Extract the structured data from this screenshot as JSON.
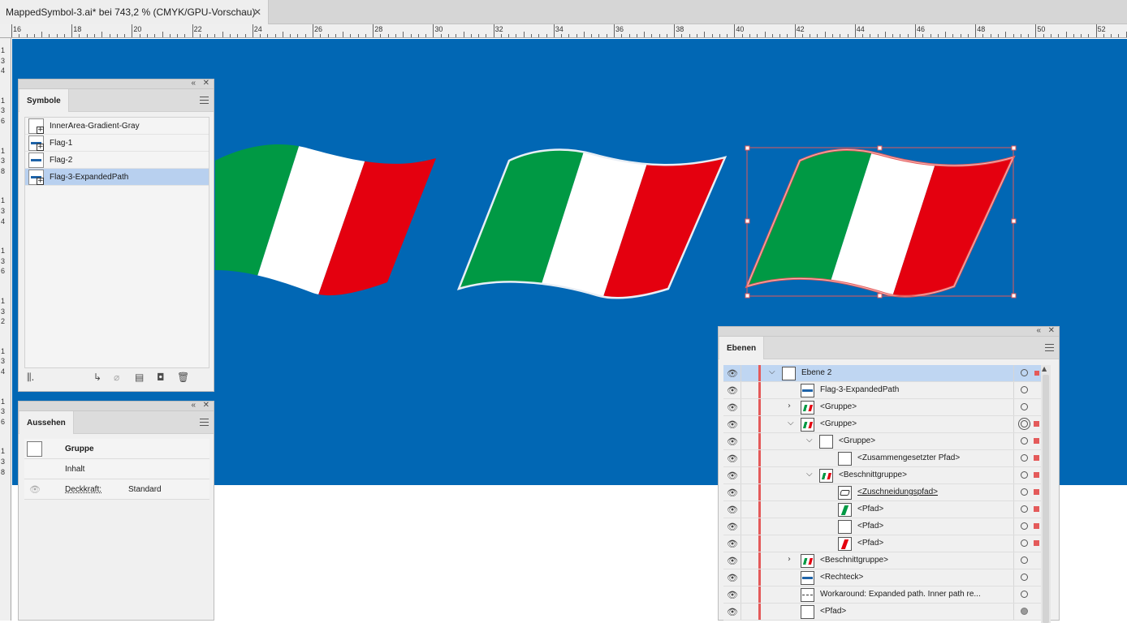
{
  "document": {
    "tab_title": "MappedSymbol-3.ai* bei 743,2 % (CMYK/GPU-Vorschau)",
    "close_glyph": "✕"
  },
  "ruler": {
    "h_labels": [
      "16",
      "18",
      "20",
      "22",
      "24",
      "26",
      "28",
      "30",
      "32",
      "34",
      "36",
      "38",
      "40",
      "42",
      "44",
      "46",
      "48",
      "50",
      "52"
    ],
    "v_labels": [
      "1",
      "3",
      "4",
      "1",
      "3",
      "6",
      "1",
      "3",
      "8",
      "1",
      "3",
      "4",
      "1",
      "3",
      "6",
      "1",
      "3",
      "2",
      "1",
      "3",
      "4",
      "1",
      "3",
      "6",
      "1",
      "3",
      "8"
    ]
  },
  "colors": {
    "artboard": "#0167b4",
    "flag_green": "#009944",
    "flag_white": "#ffffff",
    "flag_red": "#e4000f",
    "selection": "#e45a5a",
    "row_selected": "#b8d0ef"
  },
  "symbols_panel": {
    "tab": "Symbole",
    "items": [
      {
        "label": "InnerArea-Gradient-Gray",
        "icon": "gradient-symbol-icon"
      },
      {
        "label": "Flag-1",
        "icon": "flag-symbol-icon"
      },
      {
        "label": "Flag-2",
        "icon": "flag-symbol-icon"
      },
      {
        "label": "Flag-3-ExpandedPath",
        "icon": "flag-symbol-icon",
        "selected": true
      }
    ],
    "footer_icons": [
      "symbol-libraries-icon",
      "place-symbol-icon",
      "break-link-icon",
      "symbol-options-icon",
      "new-symbol-icon",
      "delete-symbol-icon"
    ]
  },
  "appearance_panel": {
    "tab": "Aussehen",
    "object_type": "Gruppe",
    "contents_label": "Inhalt",
    "opacity_label": "Deckkraft:",
    "opacity_value": "Standard"
  },
  "layers_panel": {
    "tab": "Ebenen",
    "rows": [
      {
        "name": "Ebene 2",
        "indent": 0,
        "caret": "open",
        "thumb": "blank",
        "selected": true
      },
      {
        "name": "Flag-3-ExpandedPath",
        "indent": 1,
        "caret": "none",
        "thumb": "bar"
      },
      {
        "name": "<Gruppe>",
        "indent": 1,
        "caret": "closed",
        "thumb": "flag"
      },
      {
        "name": "<Gruppe>",
        "indent": 1,
        "caret": "open",
        "thumb": "flag",
        "target": "double",
        "sel": true
      },
      {
        "name": "<Gruppe>",
        "indent": 2,
        "caret": "open",
        "thumb": "blank",
        "sel": true
      },
      {
        "name": "<Zusammengesetzter Pfad>",
        "indent": 3,
        "caret": "none",
        "thumb": "blank",
        "sel": true
      },
      {
        "name": "<Beschnittgruppe>",
        "indent": 2,
        "caret": "open",
        "thumb": "flag",
        "sel": true
      },
      {
        "name": "<Zuschneidungspfad>",
        "indent": 3,
        "caret": "none",
        "thumb": "clip",
        "sel": true,
        "underline": true
      },
      {
        "name": "<Pfad>",
        "indent": 3,
        "caret": "none",
        "thumb": "green",
        "sel": true
      },
      {
        "name": "<Pfad>",
        "indent": 3,
        "caret": "none",
        "thumb": "blank",
        "sel": true
      },
      {
        "name": "<Pfad>",
        "indent": 3,
        "caret": "none",
        "thumb": "red",
        "sel": true
      },
      {
        "name": "<Beschnittgruppe>",
        "indent": 1,
        "caret": "closed",
        "thumb": "flag"
      },
      {
        "name": "<Rechteck>",
        "indent": 1,
        "caret": "none",
        "thumb": "bar"
      },
      {
        "name": "Workaround:  Expanded path. Inner path re...",
        "indent": 1,
        "caret": "none",
        "thumb": "line"
      },
      {
        "name": "<Pfad>",
        "indent": 1,
        "caret": "none",
        "thumb": "blank",
        "target": "filled"
      }
    ]
  }
}
